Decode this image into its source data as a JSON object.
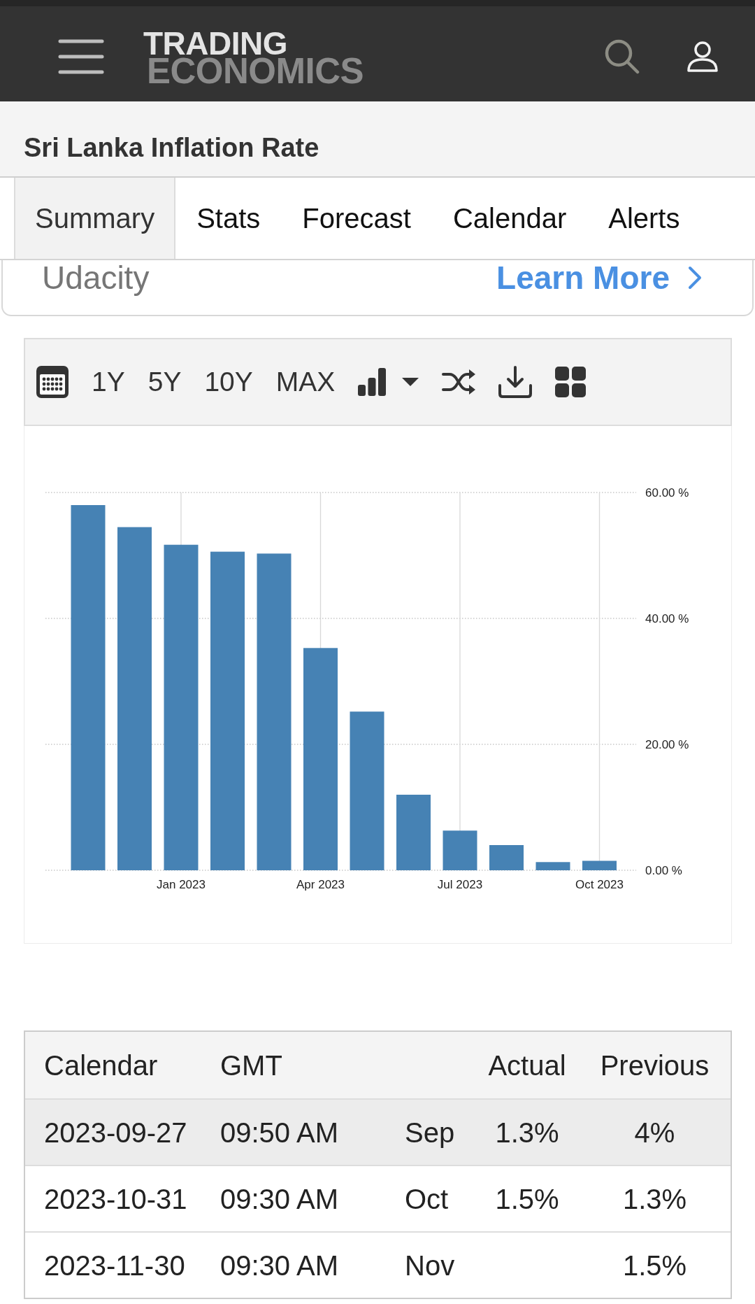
{
  "header": {
    "logo": {
      "line_1": "TRADING",
      "line_2": "ECONOMICS"
    }
  },
  "title": "Sri Lanka Inflation Rate",
  "tabs": [
    {
      "label": "Summary",
      "selected": true
    },
    {
      "label": "Stats",
      "selected": false
    },
    {
      "label": "Forecast",
      "selected": false
    },
    {
      "label": "Calendar",
      "selected": false
    },
    {
      "label": "Alerts",
      "selected": false
    }
  ],
  "ad": {
    "advertiser": "Udacity",
    "link": "Learn More"
  },
  "chart": {
    "toolbar": {
      "ranges": [
        "1Y",
        "5Y",
        "10Y",
        "MAX"
      ]
    },
    "chart_data": {
      "type": "bar",
      "categories": [
        null,
        null,
        "Jan 2023",
        null,
        null,
        "Apr 2023",
        null,
        null,
        "Jul 2023",
        null,
        null,
        "Oct 2023"
      ],
      "series": [
        {
          "color": "#4682b4",
          "values": [
            58.0,
            54.5,
            51.7,
            50.6,
            50.3,
            35.3,
            25.2,
            12.0,
            6.3,
            4.0,
            1.3,
            1.5
          ]
        }
      ],
      "ylim": [
        0,
        60
      ],
      "yticks": [
        {
          "value": 0,
          "label": "0.00 %"
        },
        {
          "value": 20,
          "label": "20.00 %"
        },
        {
          "value": 40,
          "label": "40.00 %"
        },
        {
          "value": 60,
          "label": "60.00 %"
        }
      ],
      "grid": true
    }
  },
  "table": {
    "columns": {
      "date": "Calendar",
      "time": "GMT",
      "actual": "Actual",
      "previous": "Previous"
    },
    "rows": [
      {
        "date": "2023-09-27",
        "time": "09:50 AM",
        "column_3": "Sep",
        "actual": "1.3%",
        "previous": "4%",
        "highlighted": true
      },
      {
        "date": "2023-10-31",
        "time": "09:30 AM",
        "column_3": "Oct",
        "actual": "1.5%",
        "previous": "1.3%",
        "highlighted": false
      },
      {
        "date": "2023-11-30",
        "time": "09:30 AM",
        "column_3": "Nov",
        "previous": "1.5%",
        "highlighted": false
      }
    ]
  }
}
